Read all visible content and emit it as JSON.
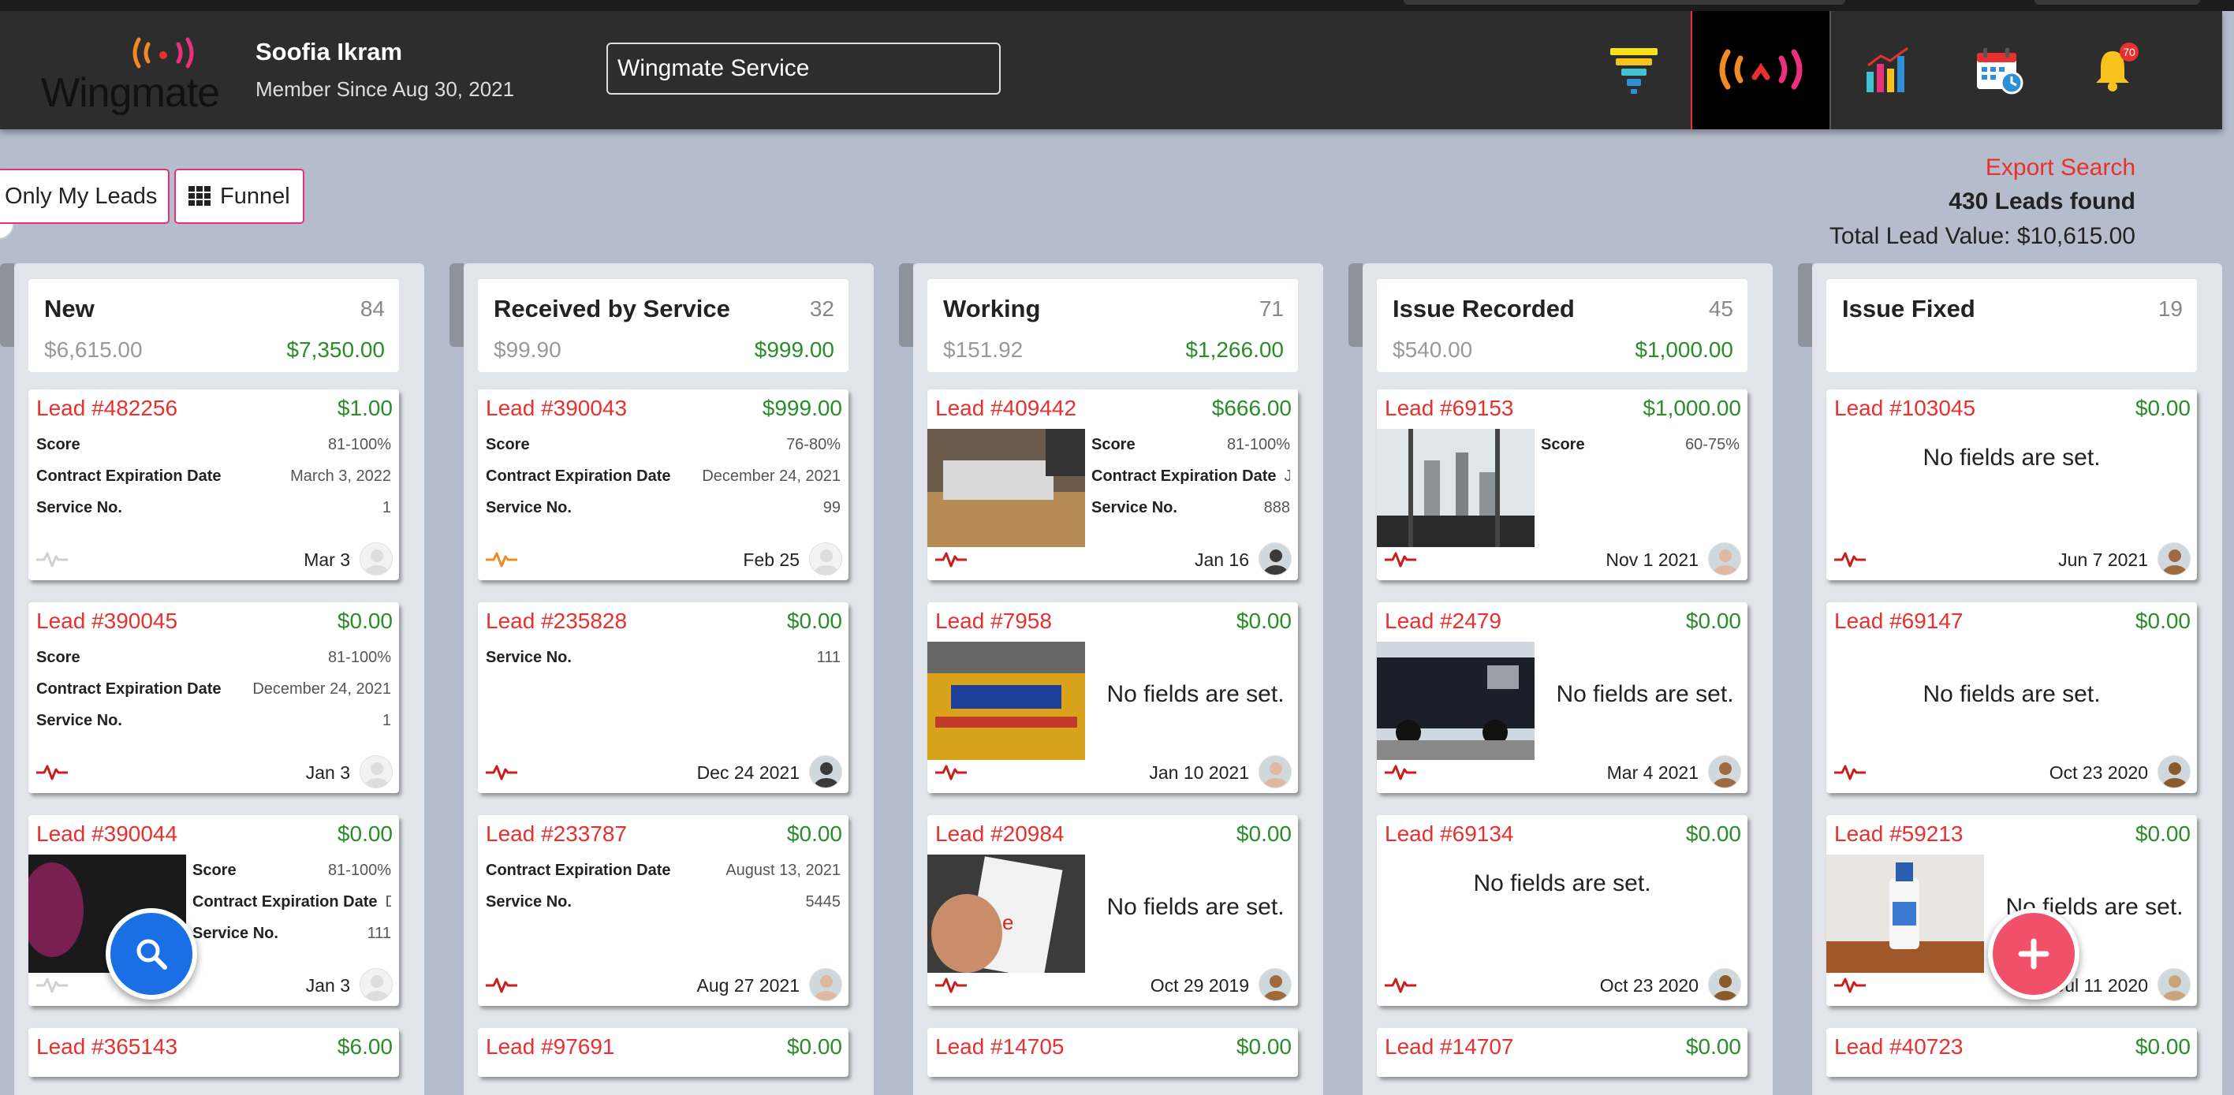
{
  "header": {
    "logo_text": "Wingmate",
    "user_name": "Soofia Ikram",
    "member_since": "Member Since Aug 30, 2021",
    "search_value": "Wingmate Service",
    "bell_count": "70"
  },
  "toolbar": {
    "only_my_leads": "Only My Leads",
    "funnel": "Funnel",
    "export_search": "Export Search",
    "leads_found": "430 Leads found",
    "total_lead_value": "Total Lead Value: $10,615.00"
  },
  "columns": [
    {
      "title": "New",
      "count": "84",
      "sum_a": "$6,615.00",
      "sum_b": "$7,350.00",
      "cards": [
        {
          "lead": "Lead #482256",
          "amount": "$1.00",
          "fields": [
            [
              "Score",
              "81-100%"
            ],
            [
              "Contract Expiration Date",
              "March 3, 2022"
            ],
            [
              "Service No.",
              "1"
            ]
          ],
          "date": "Mar 3"
        },
        {
          "lead": "Lead #390045",
          "amount": "$0.00",
          "fields": [
            [
              "Score",
              "81-100%"
            ],
            [
              "Contract Expiration Date",
              "December 24, 2021"
            ],
            [
              "Service No.",
              "1"
            ]
          ],
          "date": "Jan 3"
        },
        {
          "lead": "Lead #390044",
          "amount": "$0.00",
          "fields": [
            [
              "Score",
              "81-100%"
            ],
            [
              "Contract Expiration Date",
              "D"
            ],
            [
              "Service No.",
              "111"
            ]
          ],
          "date": "Jan 3"
        },
        {
          "lead": "Lead #365143",
          "amount": "$6.00"
        }
      ]
    },
    {
      "title": "Received by Service",
      "count": "32",
      "sum_a": "$99.90",
      "sum_b": "$999.00",
      "cards": [
        {
          "lead": "Lead #390043",
          "amount": "$999.00",
          "fields": [
            [
              "Score",
              "76-80%"
            ],
            [
              "Contract Expiration Date",
              "December 24, 2021"
            ],
            [
              "Service No.",
              "99"
            ]
          ],
          "date": "Feb 25"
        },
        {
          "lead": "Lead #235828",
          "amount": "$0.00",
          "fields": [
            [
              "Service No.",
              "111"
            ]
          ],
          "date": "Dec 24 2021"
        },
        {
          "lead": "Lead #233787",
          "amount": "$0.00",
          "fields": [
            [
              "Contract Expiration Date",
              "August 13, 2021"
            ],
            [
              "Service No.",
              "5445"
            ]
          ],
          "date": "Aug 27 2021"
        },
        {
          "lead": "Lead #97691",
          "amount": "$0.00"
        }
      ]
    },
    {
      "title": "Working",
      "count": "71",
      "sum_a": "$151.92",
      "sum_b": "$1,266.00",
      "cards": [
        {
          "lead": "Lead #409442",
          "amount": "$666.00",
          "fields": [
            [
              "Score",
              "81-100%"
            ],
            [
              "Contract Expiration Date",
              "J."
            ],
            [
              "Service No.",
              "888"
            ]
          ],
          "date": "Jan 16"
        },
        {
          "lead": "Lead #7958",
          "amount": "$0.00",
          "no_fields": "No fields are set.",
          "date": "Jan 10 2021"
        },
        {
          "lead": "Lead #20984",
          "amount": "$0.00",
          "no_fields": "No fields are set.",
          "date": "Oct 29 2019"
        },
        {
          "lead": "Lead #14705",
          "amount": "$0.00"
        }
      ]
    },
    {
      "title": "Issue Recorded",
      "count": "45",
      "sum_a": "$540.00",
      "sum_b": "$1,000.00",
      "cards": [
        {
          "lead": "Lead #69153",
          "amount": "$1,000.00",
          "fields": [
            [
              "Score",
              "60-75%"
            ]
          ],
          "date": "Nov 1 2021"
        },
        {
          "lead": "Lead #2479",
          "amount": "$0.00",
          "no_fields": "No fields are set.",
          "date": "Mar 4 2021"
        },
        {
          "lead": "Lead #69134",
          "amount": "$0.00",
          "no_fields": "No fields are set.",
          "date": "Oct 23 2020"
        },
        {
          "lead": "Lead #14707",
          "amount": "$0.00"
        }
      ]
    },
    {
      "title": "Issue Fixed",
      "count": "19",
      "cards": [
        {
          "lead": "Lead #103045",
          "amount": "$0.00",
          "no_fields": "No fields are set.",
          "date": "Jun 7 2021"
        },
        {
          "lead": "Lead #69147",
          "amount": "$0.00",
          "no_fields": "No fields are set.",
          "date": "Oct 23 2020"
        },
        {
          "lead": "Lead #59213",
          "amount": "$0.00",
          "no_fields": "No fields are set.",
          "date": "Jul 11 2020"
        },
        {
          "lead": "Lead #40723",
          "amount": "$0.00"
        }
      ]
    }
  ],
  "colors": {
    "accent_red": "#e8312f",
    "money_green": "#2a8c2a",
    "header_bg": "#2d2d2d"
  }
}
